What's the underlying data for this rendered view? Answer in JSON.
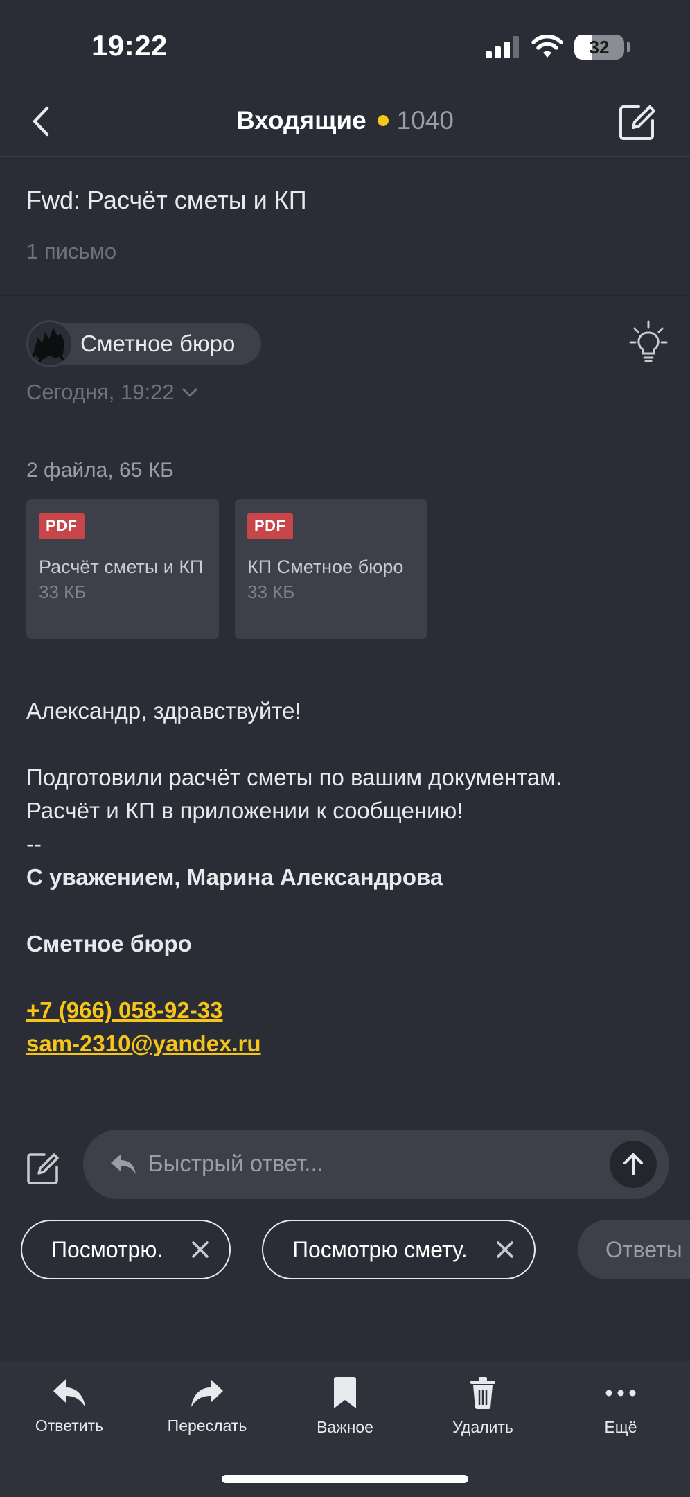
{
  "status": {
    "time": "19:22",
    "battery": "32"
  },
  "nav": {
    "title": "Входящие",
    "unread_count": "1040",
    "dot_color": "#f5c518"
  },
  "thread": {
    "subject": "Fwd: Расчёт сметы и КП",
    "letters": "1 письмо"
  },
  "sender": {
    "name": "Сметное бюро",
    "date": "Сегодня, 19:22"
  },
  "attachments": {
    "summary": "2 файла, 65 КБ",
    "files": [
      {
        "type": "PDF",
        "name": "Расчёт сметы и КП",
        "size": "33 КБ"
      },
      {
        "type": "PDF",
        "name": "КП Сметное бюро",
        "size": "33 КБ"
      }
    ]
  },
  "body": {
    "greeting": "Александр, здравствуйте!",
    "line1": "Подготовили расчёт сметы по вашим документам.",
    "line2": "Расчёт и КП в приложении к сообщению!",
    "separator": "--",
    "signature": "С уважением, Марина Александрова",
    "company": "Сметное бюро",
    "phone": "+7 (966) 058-92-33",
    "email": "sam-2310@yandex.ru"
  },
  "quick_reply": {
    "placeholder": "Быстрый ответ...",
    "suggestions": [
      "Посмотрю.",
      "Посмотрю смету."
    ],
    "more": "Ответы"
  },
  "toolbar": {
    "reply": "Ответить",
    "forward": "Переслать",
    "important": "Важное",
    "delete": "Удалить",
    "more": "Ещё"
  },
  "colors": {
    "background": "#2a2d35",
    "accent": "#f5c518",
    "pdf_badge": "#c8454a"
  }
}
